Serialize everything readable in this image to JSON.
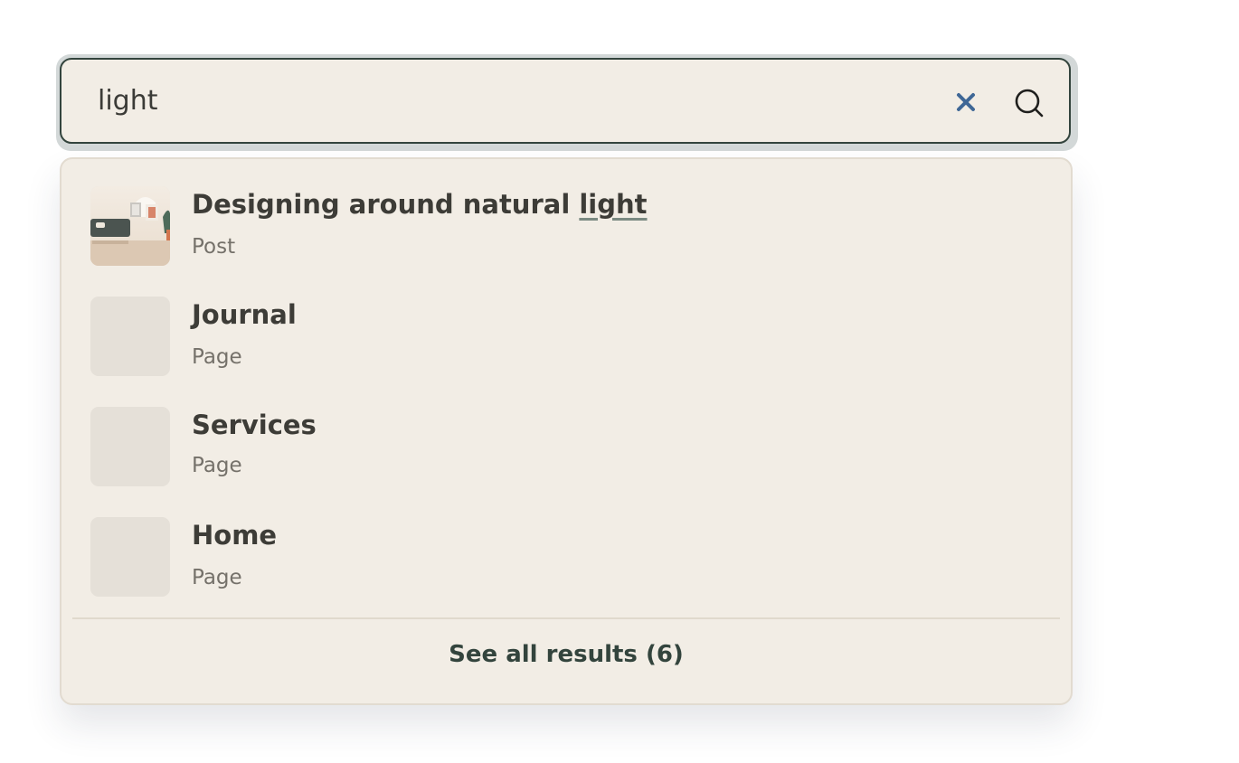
{
  "search": {
    "value": "light",
    "placeholder": ""
  },
  "icons": {
    "clear": "close-icon",
    "search": "search-icon"
  },
  "colors": {
    "surface": "#f2ede5",
    "border": "#33443d",
    "clear_icon": "#3f6796",
    "text": "#3d3c37",
    "muted": "#75716a"
  },
  "results": [
    {
      "title_prefix": "Designing around natural ",
      "title_highlight": "light",
      "type": "Post",
      "has_thumbnail": true
    },
    {
      "title_prefix": "Journal",
      "title_highlight": "",
      "type": "Page",
      "has_thumbnail": false
    },
    {
      "title_prefix": "Services",
      "title_highlight": "",
      "type": "Page",
      "has_thumbnail": false
    },
    {
      "title_prefix": "Home",
      "title_highlight": "",
      "type": "Page",
      "has_thumbnail": false
    }
  ],
  "footer": {
    "see_all_label": "See all results (6)"
  }
}
